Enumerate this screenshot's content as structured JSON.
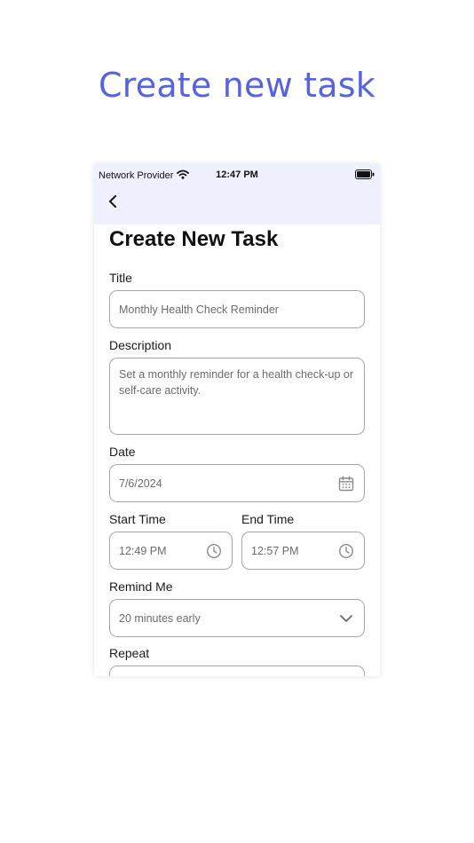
{
  "promo": {
    "title": "Create new task"
  },
  "status_bar": {
    "carrier": "Network Provider",
    "time": "12:47 PM"
  },
  "screen": {
    "heading": "Create New Task"
  },
  "form": {
    "title_label": "Title",
    "title_value": "Monthly Health Check Reminder",
    "description_label": "Description",
    "description_value": "Set a monthly reminder for a health check-up or self-care activity.",
    "date_label": "Date",
    "date_value": "7/6/2024",
    "start_time_label": "Start Time",
    "start_time_value": "12:49 PM",
    "end_time_label": "End Time",
    "end_time_value": "12:57 PM",
    "remind_label": "Remind Me",
    "remind_value": "20 minutes early",
    "repeat_label": "Repeat"
  },
  "icons": {
    "back": "chevron-left-icon",
    "date": "calendar-icon",
    "time": "clock-icon",
    "dropdown": "chevron-down-icon",
    "wifi": "wifi-icon",
    "battery": "battery-icon"
  },
  "colors": {
    "accent": "#5563e0",
    "appbar": "#eff0fd",
    "border": "#a6a6a6"
  }
}
